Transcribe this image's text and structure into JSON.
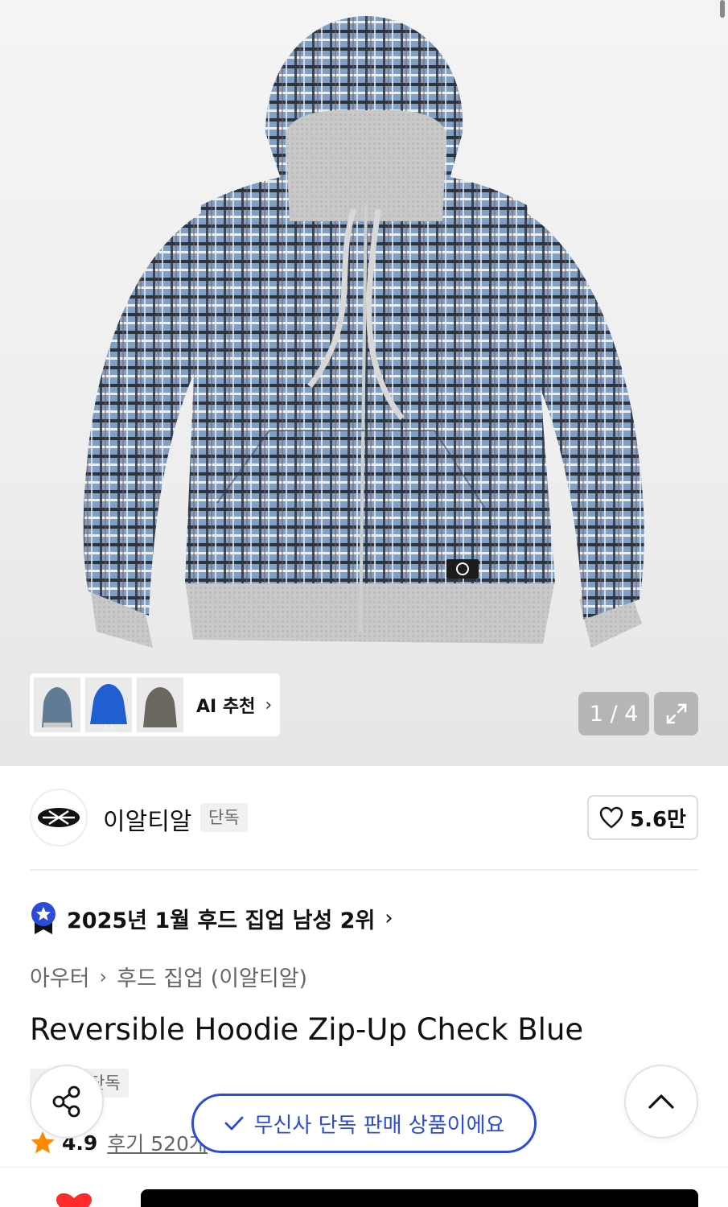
{
  "gallery": {
    "ai_recommend_label": "AI 추천",
    "counter": "1 / 4",
    "thumbnail_colors": [
      "#5f7b95",
      "#1f5fd0",
      "#6a6761"
    ]
  },
  "brand": {
    "name": "이알티알",
    "exclusive_tag": "단독",
    "likes": "5.6만"
  },
  "ranking": {
    "text": "2025년 1월 후드 집업 남성 2위"
  },
  "breadcrumb": {
    "level1": "아우터",
    "level2": "후드 집업 (이알티알)"
  },
  "product": {
    "title": "Reversible Hoodie Zip-Up Check Blue",
    "exclusive_tag": "단독",
    "rating": "4.9",
    "reviews": "후기 520개"
  },
  "toast": {
    "message": "무신사 단독 판매 상품이에요"
  },
  "colors": {
    "accent_blue": "#2b4bdb",
    "star": "#ff8a00",
    "heart": "#ff2a2a"
  }
}
